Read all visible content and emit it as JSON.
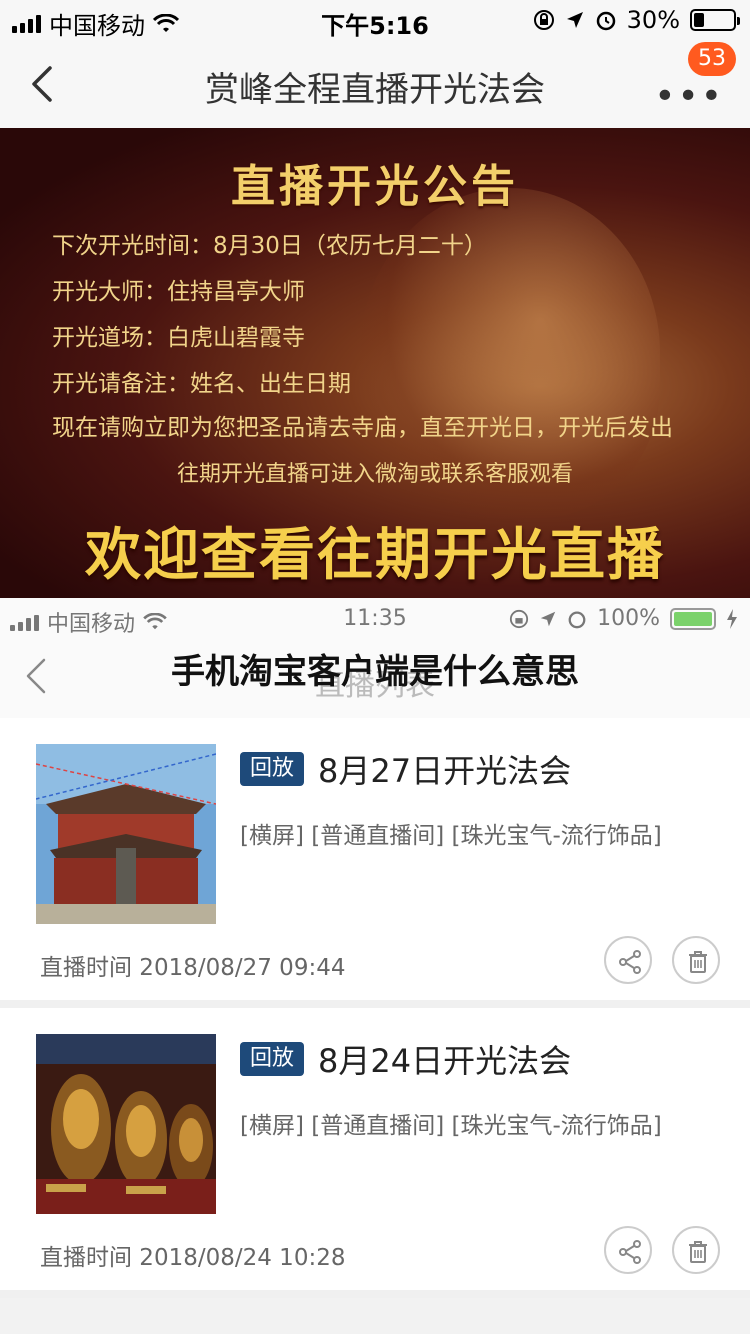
{
  "status_top": {
    "carrier": "中国移动",
    "time": "下午5:16",
    "battery": "30%"
  },
  "header": {
    "title": "赏峰全程直播开光法会",
    "badge": "53"
  },
  "banner": {
    "heading": "直播开光公告",
    "lines": [
      "下次开光时间：8月30日（农历七月二十）",
      "开光大师：住持昌亭大师",
      "开光道场：白虎山碧霞寺",
      "开光请备注：姓名、出生日期",
      "现在请购立即为您把圣品请去寺庙，直至开光日，开光后发出"
    ],
    "sub": "往期开光直播可进入微淘或联系客服观看",
    "big": "欢迎查看往期开光直播"
  },
  "status_inner": {
    "carrier": "中国移动",
    "time": "11:35",
    "battery": "100%"
  },
  "inner_nav": {
    "ghost_title": "直播列表",
    "overlay_title": "手机淘宝客户端是什么意思"
  },
  "cards": [
    {
      "tag": "回放",
      "title": "8月27日开光法会",
      "desc": "[横屏] [普通直播间] [珠光宝气-流行饰品]",
      "time": "直播时间 2018/08/27   09:44"
    },
    {
      "tag": "回放",
      "title": "8月24日开光法会",
      "desc": "[横屏] [普通直播间] [珠光宝气-流行饰品]",
      "time": "直播时间 2018/08/24   10:28"
    }
  ],
  "colors": {
    "badge": "#ff5a1f",
    "tag": "#1e4a7a",
    "banner_gold": "#f6cf4c"
  }
}
